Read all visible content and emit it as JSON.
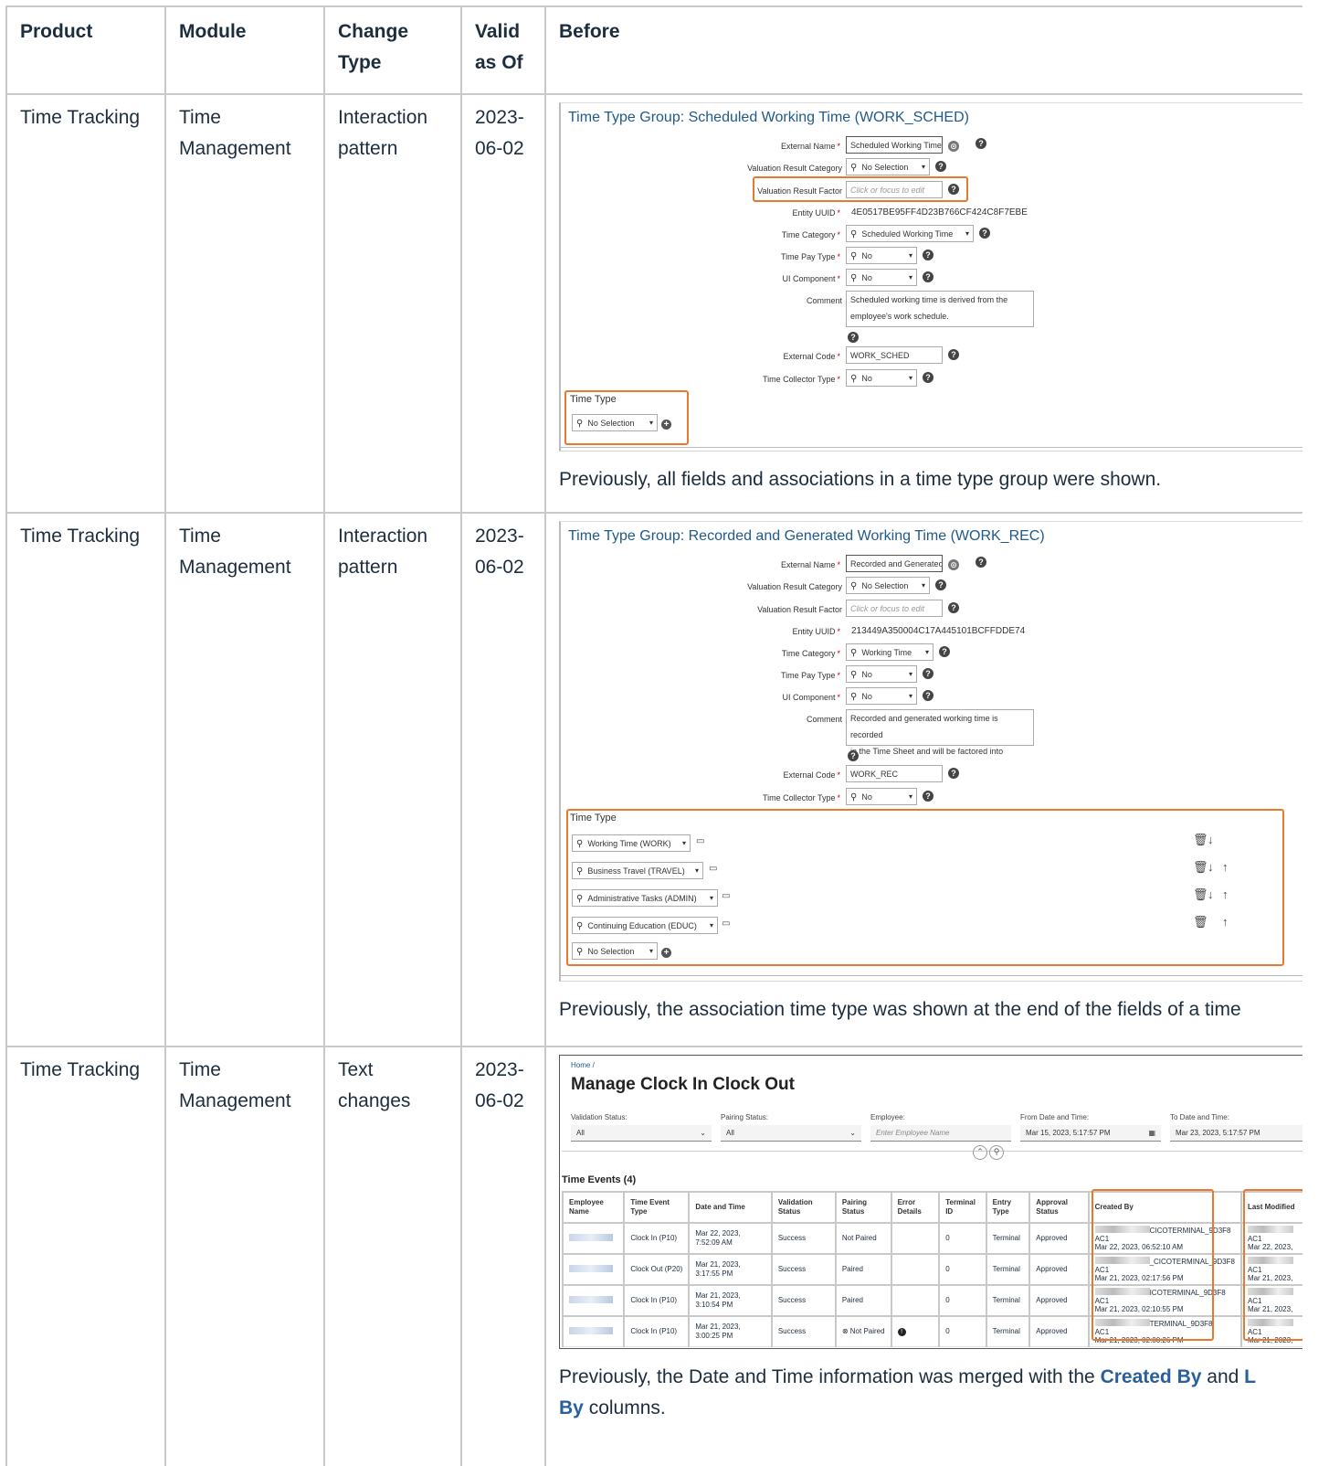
{
  "headers": {
    "product": "Product",
    "module": "Module",
    "change_type": "Change Type",
    "valid_as_of": "Valid as Of",
    "before": "Before"
  },
  "rows": [
    {
      "product": "Time Tracking",
      "module": "Time Management",
      "change_type": "Interaction pattern",
      "valid": "2023-06-02",
      "caption": "Previously, all fields and associations in a time type group were shown."
    },
    {
      "product": "Time Tracking",
      "module": "Time Management",
      "change_type": "Interaction pattern",
      "valid": "2023-06-02",
      "caption": "Previously, the association time type was shown at the end of the fields of a time"
    },
    {
      "product": "Time Tracking",
      "module": "Time Management",
      "change_type": "Text changes",
      "valid": "2023-06-02",
      "caption_a": "Previously, the Date and Time information was merged with the ",
      "caption_link1": "Created By",
      "caption_b": " and ",
      "caption_link2": "L",
      "caption_link2b": "By",
      "caption_c": " columns."
    }
  ],
  "shot1": {
    "title": "Time Type Group: Scheduled Working Time (WORK_SCHED)",
    "labels": {
      "external_name": "External Name",
      "val_cat": "Valuation Result Category",
      "val_factor": "Valuation Result Factor",
      "uuid": "Entity UUID",
      "time_cat": "Time Category",
      "pay_type": "Time Pay Type",
      "ui_comp": "UI Component",
      "comment": "Comment",
      "ext_code": "External Code",
      "collector": "Time Collector Type",
      "time_type": "Time Type"
    },
    "values": {
      "external_name": "Scheduled Working Time",
      "val_cat": "No Selection",
      "val_factor": "Click or focus to edit",
      "uuid": "4E0517BE95FF4D23B766CF424C8F7EBE",
      "time_cat": "Scheduled Working Time",
      "pay_type": "No",
      "ui_comp": "No",
      "comment1": "Scheduled working time is derived from the",
      "comment2": "employee's work schedule.",
      "ext_code": "WORK_SCHED",
      "collector": "No",
      "time_type": "No Selection"
    }
  },
  "shot2": {
    "title": "Time Type Group: Recorded and Generated Working Time (WORK_REC)",
    "labels": {
      "external_name": "External Name",
      "val_cat": "Valuation Result Category",
      "val_factor": "Valuation Result Factor",
      "uuid": "Entity UUID",
      "time_cat": "Time Category",
      "pay_type": "Time Pay Type",
      "ui_comp": "UI Component",
      "comment": "Comment",
      "ext_code": "External Code",
      "collector": "Time Collector Type",
      "time_type": "Time Type"
    },
    "values": {
      "external_name": "Recorded and Generated",
      "val_cat": "No Selection",
      "val_factor": "Click or focus to edit",
      "uuid": "213449A350004C17A445101BCFFDDE74",
      "time_cat": "Working Time",
      "pay_type": "No",
      "ui_comp": "No",
      "comment1": "Recorded and generated working time is recorded",
      "comment2": "in the Time Sheet and will be factored into",
      "ext_code": "WORK_REC",
      "collector": "No"
    },
    "time_types": [
      "Working Time (WORK)",
      "Business Travel (TRAVEL)",
      "Administrative Tasks (ADMIN)",
      "Continuing Education (EDUC)",
      "No Selection"
    ]
  },
  "shot3": {
    "breadcrumb": "Home /",
    "title": "Manage Clock In Clock Out",
    "filters": {
      "validation_label": "Validation Status:",
      "validation_value": "All",
      "pairing_label": "Pairing Status:",
      "pairing_value": "All",
      "employee_label": "Employee:",
      "employee_placeholder": "Enter Employee Name",
      "from_label": "From Date and Time:",
      "from_value": "Mar 15, 2023, 5:17:57 PM",
      "to_label": "To Date and Time:",
      "to_value": "Mar 23, 2023, 5:17:57 PM"
    },
    "events_title": "Time Events (4)",
    "columns": [
      "Employee Name",
      "Time Event Type",
      "Date and Time",
      "Validation Status",
      "Pairing Status",
      "Error Details",
      "Terminal ID",
      "Entry Type",
      "Approval Status",
      "Created By",
      "Last Modified"
    ],
    "rows": [
      {
        "type": "Clock In (P10)",
        "date": "Mar 22, 2023, 7:52:09 AM",
        "validation": "Success",
        "pairing": "Not Paired",
        "terminal": "0",
        "entry": "Terminal",
        "approval": "Approved",
        "created_a": "CICOTERMINAL_9D3F8",
        "created_b": "AC1",
        "created_c": "Mar 22, 2023, 06:52:10 AM",
        "mod_b": "AC1",
        "mod_c": "Mar 22, 2023,"
      },
      {
        "type": "Clock Out (P20)",
        "date": "Mar 21, 2023, 3:17:55 PM",
        "validation": "Success",
        "pairing": "Paired",
        "terminal": "0",
        "entry": "Terminal",
        "approval": "Approved",
        "created_a": "_CICOTERMINAL_9D3F8",
        "created_b": "AC1",
        "created_c": "Mar 21, 2023, 02:17:56 PM",
        "mod_b": "AC1",
        "mod_c": "Mar 21, 2023,"
      },
      {
        "type": "Clock In (P10)",
        "date": "Mar 21, 2023, 3:10:54 PM",
        "validation": "Success",
        "pairing": "Paired",
        "terminal": "0",
        "entry": "Terminal",
        "approval": "Approved",
        "created_a": "ICOTERMINAL_9D3F8",
        "created_b": "AC1",
        "created_c": "Mar 21, 2023, 02:10:55 PM",
        "mod_b": "AC1",
        "mod_c": "Mar 21, 2023,"
      },
      {
        "type": "Clock In (P10)",
        "date": "Mar 21, 2023, 3:00:25 PM",
        "validation": "Success",
        "pairing": "Not Paired",
        "terminal": "0",
        "entry": "Terminal",
        "approval": "Approved",
        "created_a": "TERMINAL_9D3F8",
        "created_b": "AC1",
        "created_c": "Mar 21, 2023, 02:00:26 PM",
        "mod_b": "AC1",
        "mod_c": "Mar 21, 2023,"
      }
    ]
  },
  "colors": {
    "highlight": "#e9782f",
    "link": "#2a5f9e",
    "success": "#2b8a2b",
    "error": "#cc0000"
  }
}
